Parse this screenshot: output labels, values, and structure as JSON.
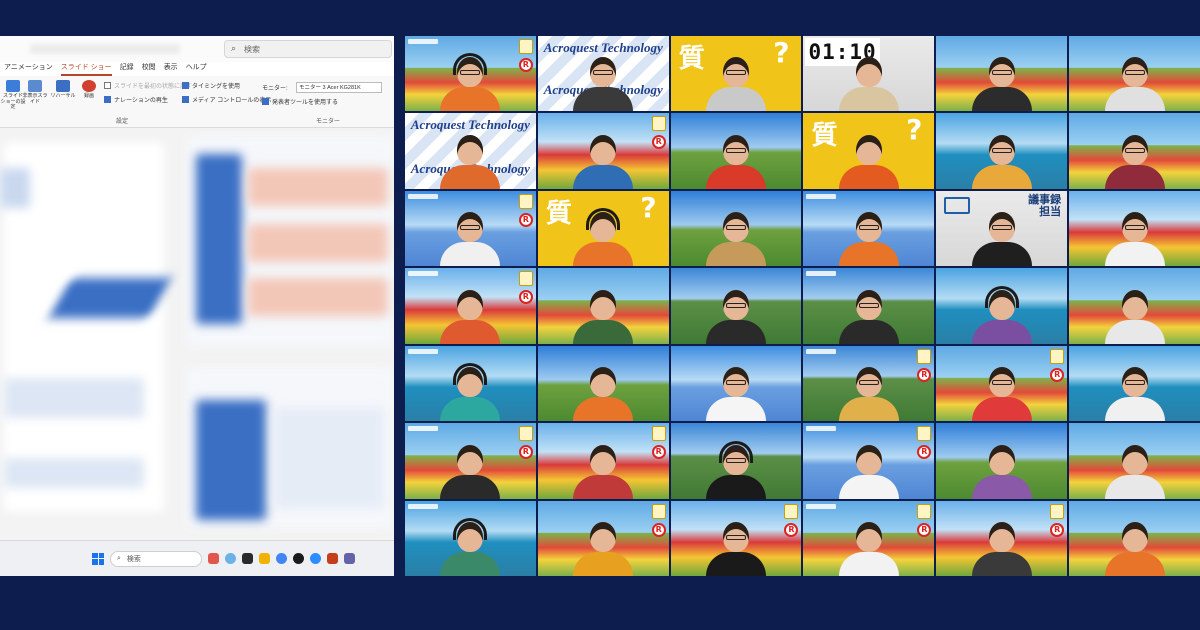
{
  "powerpoint": {
    "search_placeholder": "検索",
    "tabs": [
      "アニメーション",
      "スライド ショー",
      "記録",
      "校閲",
      "表示",
      "ヘルプ"
    ],
    "active_tab": "スライド ショー",
    "ribbon": {
      "buttons": [
        {
          "label": "スライド ショーの設定",
          "icon": "slideshow-setup-icon"
        },
        {
          "label": "非表示スライド",
          "icon": "hide-slide-icon"
        },
        {
          "label": "リハーサル",
          "icon": "rehearse-timings-icon"
        },
        {
          "label": "録画",
          "icon": "record-icon"
        }
      ],
      "checkboxes": [
        {
          "label": "スライドを最初の状態に戻す",
          "checked": false
        },
        {
          "label": "ナレーションの再生",
          "checked": true
        },
        {
          "label": "タイミングを使用",
          "checked": true
        },
        {
          "label": "メディア コントロールの表示",
          "checked": true
        },
        {
          "label": "発表者ツールを使用する",
          "checked": true
        }
      ],
      "monitor_label": "モニター:",
      "monitor_value": "モニター 3 Acer KG281K",
      "group_setup": "設定",
      "group_monitor": "モニター"
    },
    "taskbar_search": "検索",
    "colors": {
      "accent": "#b7472a",
      "windows_blue": "#1a73e8"
    }
  },
  "grid": {
    "rows": 7,
    "cols": 6,
    "overlays": {
      "timer": "01:10",
      "question_kanji": "質",
      "question_mark": "?",
      "logo_text": "Acroquest Technology",
      "role_text_line1": "議事録",
      "role_text_line2": "担当",
      "badge_letter": "R"
    },
    "tiles": [
      {
        "bg": "field",
        "shirt": "#e8742a",
        "headset": true,
        "glasses": true,
        "badge": true
      },
      {
        "bg": "logo",
        "shirt": "#3a3a3a",
        "glasses": true
      },
      {
        "bg": "yellow-question",
        "shirt": "#c9c9c9",
        "glasses": true
      },
      {
        "bg": "timer",
        "shirt": "#d9c6a0"
      },
      {
        "bg": "field",
        "shirt": "#2c2c2c",
        "glasses": true
      },
      {
        "bg": "field",
        "shirt": "#e0e0e0",
        "glasses": true
      },
      {
        "bg": "logo-low",
        "shirt": "#e06a2b"
      },
      {
        "bg": "windmill",
        "shirt": "#2f6db5",
        "badge": true
      },
      {
        "bg": "hill",
        "shirt": "#d93a2a",
        "glasses": true
      },
      {
        "bg": "yellow-question",
        "shirt": "#e35b1e"
      },
      {
        "bg": "sea",
        "shirt": "#e8a93a",
        "glasses": true
      },
      {
        "bg": "field",
        "shirt": "#8f2b3a",
        "glasses": true
      },
      {
        "bg": "nemophila",
        "shirt": "#f0f0f0",
        "glasses": true,
        "badge": true
      },
      {
        "bg": "yellow-question",
        "shirt": "#e8742a",
        "headset": true
      },
      {
        "bg": "hill",
        "shirt": "#c69a5a",
        "glasses": true
      },
      {
        "bg": "nemophila",
        "shirt": "#e8742a",
        "glasses": true
      },
      {
        "bg": "whiteboard-role",
        "shirt": "#1f1f1f",
        "glasses": true
      },
      {
        "bg": "windmill",
        "shirt": "#f2f2f2",
        "glasses": true
      },
      {
        "bg": "windmill",
        "shirt": "#e05a30",
        "badge": true
      },
      {
        "bg": "field",
        "shirt": "#3a6a3a"
      },
      {
        "bg": "mountain",
        "shirt": "#2a2a2a",
        "glasses": true
      },
      {
        "bg": "mountain",
        "shirt": "#2a2a2a",
        "glasses": true
      },
      {
        "bg": "sea",
        "shirt": "#7a4ea0",
        "headset": true
      },
      {
        "bg": "field",
        "shirt": "#e8e8e8"
      },
      {
        "bg": "sea",
        "shirt": "#2ca8a0",
        "headset": true
      },
      {
        "bg": "hill",
        "shirt": "#e8742a"
      },
      {
        "bg": "nemophila",
        "shirt": "#f5f5f5",
        "glasses": true
      },
      {
        "bg": "mountain",
        "shirt": "#e0b14a",
        "glasses": true,
        "badge": true
      },
      {
        "bg": "field",
        "shirt": "#e03a3a",
        "glasses": true,
        "badge": true
      },
      {
        "bg": "sea",
        "shirt": "#f0f0f0",
        "glasses": true
      },
      {
        "bg": "field",
        "shirt": "#2a2a2a",
        "badge": true
      },
      {
        "bg": "windmill",
        "shirt": "#c03a3a",
        "badge": true
      },
      {
        "bg": "mountain",
        "shirt": "#1a1a1a",
        "headset": true,
        "glasses": true
      },
      {
        "bg": "nemophila",
        "shirt": "#f4f4f4",
        "badge": true
      },
      {
        "bg": "hill",
        "shirt": "#8a5aa8"
      },
      {
        "bg": "field",
        "shirt": "#e8e8e8"
      },
      {
        "bg": "sea",
        "shirt": "#3a8a6a",
        "headset": true
      },
      {
        "bg": "field",
        "shirt": "#e8a020",
        "badge": true
      },
      {
        "bg": "windmill",
        "shirt": "#1a1a1a",
        "glasses": true,
        "badge": true
      },
      {
        "bg": "field",
        "shirt": "#f2f2f2",
        "badge": true
      },
      {
        "bg": "windmill",
        "shirt": "#3a3a3a",
        "badge": true
      },
      {
        "bg": "field",
        "shirt": "#e8742a"
      }
    ]
  }
}
